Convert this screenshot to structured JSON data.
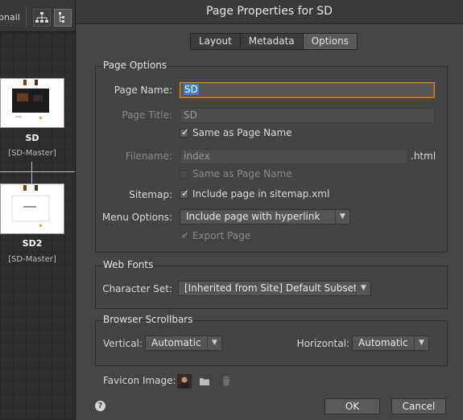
{
  "background": {
    "toolbar_label": "bnail",
    "pages": [
      {
        "name": "SD",
        "master": "[SD-Master]"
      },
      {
        "name": "SD2",
        "master": "[SD-Master]"
      }
    ]
  },
  "dialog": {
    "title": "Page Properties for SD",
    "tabs": [
      {
        "label": "Layout",
        "active": false
      },
      {
        "label": "Metadata",
        "active": false
      },
      {
        "label": "Options",
        "active": true
      }
    ],
    "page_options": {
      "group_title": "Page Options",
      "page_name_label": "Page Name:",
      "page_name_value": "SD",
      "page_title_label": "Page Title:",
      "page_title_value": "SD",
      "same_as_page_name_1": {
        "label": "Same as Page Name",
        "checked": true,
        "enabled": true
      },
      "filename_label": "Filename:",
      "filename_value": "index",
      "filename_ext": ".html",
      "same_as_page_name_2": {
        "label": "Same as Page Name",
        "checked": false,
        "enabled": false
      },
      "sitemap_label": "Sitemap:",
      "include_sitemap": {
        "label": "Include page in sitemap.xml",
        "checked": true,
        "enabled": true
      },
      "menu_options_label": "Menu Options:",
      "menu_options_value": "Include page with hyperlink",
      "export_page": {
        "label": "Export Page",
        "checked": true,
        "enabled": false
      }
    },
    "web_fonts": {
      "group_title": "Web Fonts",
      "character_set_label": "Character Set:",
      "character_set_value": "[Inherited from Site] Default Subset"
    },
    "browser_scrollbars": {
      "group_title": "Browser Scrollbars",
      "vertical_label": "Vertical:",
      "vertical_value": "Automatic",
      "horizontal_label": "Horizontal:",
      "horizontal_value": "Automatic"
    },
    "favicon": {
      "label": "Favicon Image:"
    },
    "help_icon": "?",
    "ok_label": "OK",
    "cancel_label": "Cancel"
  },
  "colors": {
    "focus_border": "#d98222",
    "selection": "#3d7fd6",
    "dialog_bg": "#454545"
  }
}
